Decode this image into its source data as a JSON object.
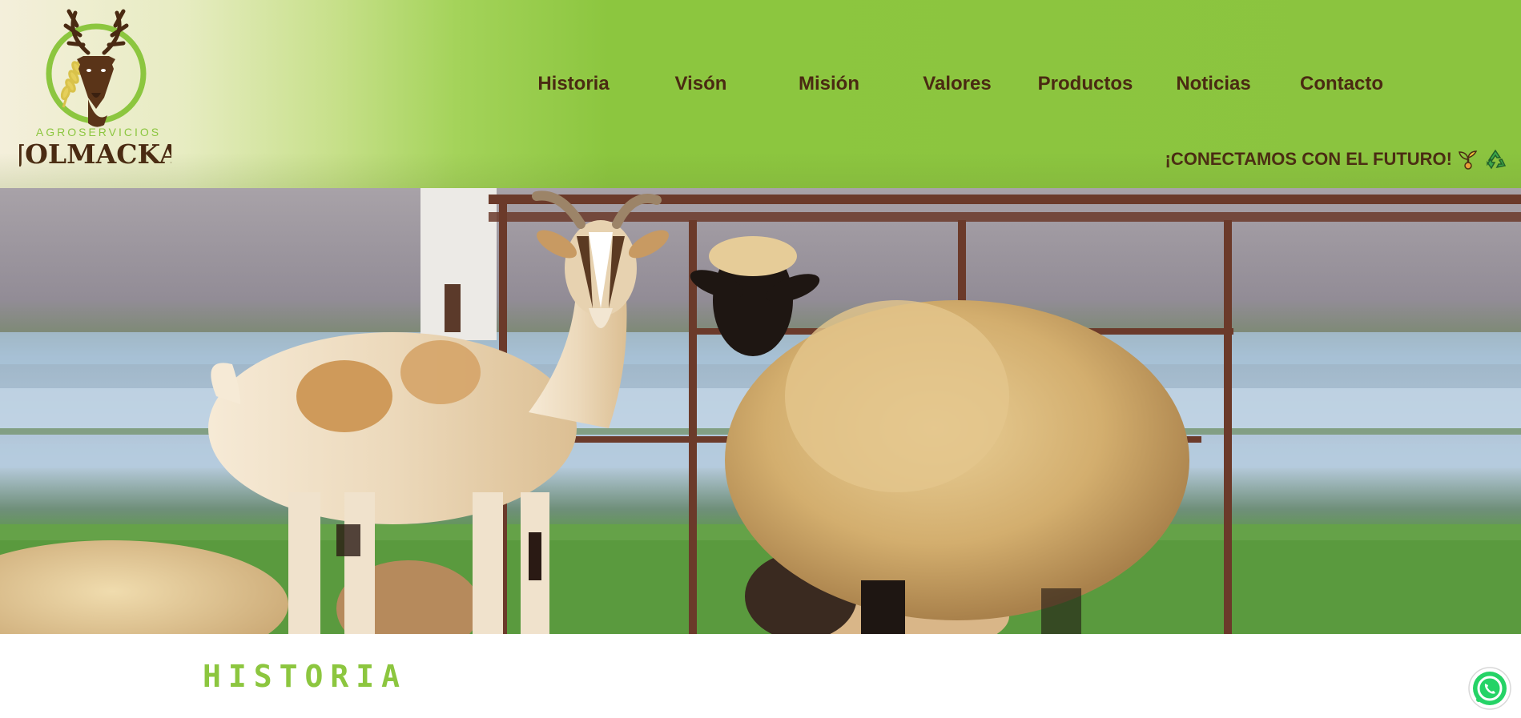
{
  "brand": {
    "logo_small_text": "AGROSERVICIOS",
    "logo_name": "JOLMACKA"
  },
  "nav": {
    "items": [
      {
        "label": "Historia"
      },
      {
        "label": "Visón"
      },
      {
        "label": "Misión"
      },
      {
        "label": "Valores"
      },
      {
        "label": "Productos"
      },
      {
        "label": "Noticias"
      },
      {
        "label": "Contacto"
      }
    ]
  },
  "header": {
    "slogan": "¡CONECTAMOS CON EL FUTURO!",
    "slogan_icons": [
      "seedling-icon",
      "recycle-icon"
    ]
  },
  "hero": {
    "image_alt": "hero-photo"
  },
  "section": {
    "title": "HISTORIA"
  },
  "floating": {
    "whatsapp_icon": "whatsapp-icon"
  },
  "colors": {
    "brand_green": "#8cc63f",
    "brand_brown": "#4a2a12",
    "whatsapp_green": "#25d366"
  }
}
